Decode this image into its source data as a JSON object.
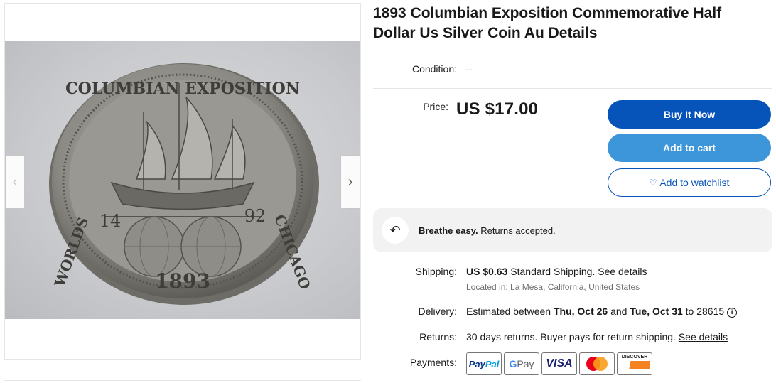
{
  "listing": {
    "title": "1893 Columbian Exposition Commemorative Half Dollar Us Silver Coin Au Details",
    "condition_label": "Condition:",
    "condition_value": "--",
    "price_label": "Price:",
    "price_value": "US $17.00"
  },
  "gallery": {
    "prev_arrow": "‹",
    "next_arrow": "›",
    "coin": {
      "top_text": "COLUMBIAN EXPOSITION",
      "left_text": "WORLDS",
      "right_text": "CHICAGO",
      "year_left": "14",
      "year_right": "92",
      "bottom_year": "1893"
    }
  },
  "actions": {
    "buy_now": "Buy It Now",
    "add_to_cart": "Add to cart",
    "add_to_watchlist": "Add to watchlist"
  },
  "returns_banner": {
    "bold": "Breathe easy.",
    "text": " Returns accepted."
  },
  "shipping": {
    "label": "Shipping:",
    "price": "US $0.63",
    "method": " Standard Shipping. ",
    "link": "See details",
    "location": "Located in: La Mesa, California, United States"
  },
  "delivery": {
    "label": "Delivery:",
    "prefix": "Estimated between ",
    "date_start": "Thu, Oct 26",
    "and": " and ",
    "date_end": "Tue, Oct 31",
    "suffix": " to 28615"
  },
  "returns": {
    "label": "Returns:",
    "text": "30 days returns. Buyer pays for return shipping. ",
    "link": "See details"
  },
  "payments": {
    "label": "Payments:",
    "paypal": [
      "Pay",
      "Pal"
    ],
    "gpay": [
      "G",
      " Pay"
    ],
    "visa": "VISA",
    "discover": "DISCOVER"
  },
  "colors": {
    "primary_blue": "#0654ba",
    "cart_blue": "#3d96d9"
  }
}
